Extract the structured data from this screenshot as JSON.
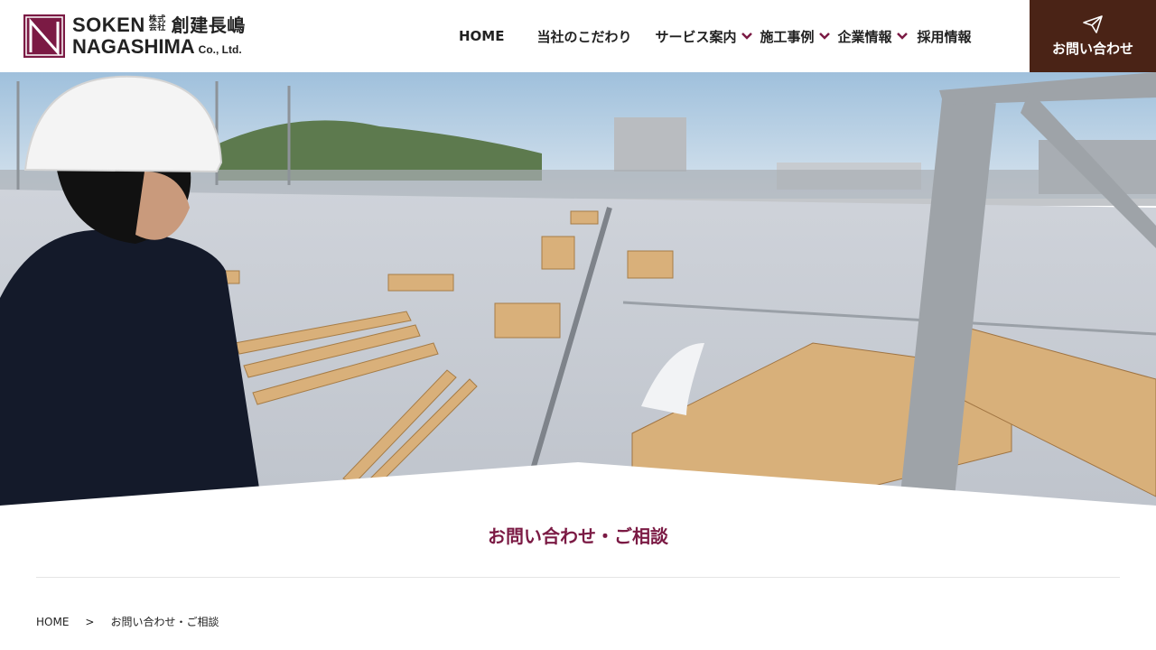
{
  "header": {
    "logo": {
      "line1": "SOKEN",
      "line1_sub": "株式\n会社",
      "line1_jp": "創建長嶋",
      "line2": "NAGASHIMA",
      "line2_co": "Co., Ltd."
    },
    "nav": [
      {
        "label": "HOME",
        "dropdown": false
      },
      {
        "label": "当社のこだわり",
        "dropdown": false
      },
      {
        "label": "サービス案内",
        "dropdown": true
      },
      {
        "label": "施工事例",
        "dropdown": true
      },
      {
        "label": "企業情報",
        "dropdown": true
      },
      {
        "label": "採用情報",
        "dropdown": false
      }
    ],
    "contact_button": {
      "label": "お問い合わせ",
      "icon": "paper-plane-icon"
    }
  },
  "hero": {
    "image": "construction-site-photo"
  },
  "page": {
    "title": "お問い合わせ・ご相談",
    "breadcrumb": {
      "home": "HOME",
      "separator": ">",
      "current": "お問い合わせ・ご相談"
    }
  },
  "colors": {
    "accent": "#7b1a44",
    "contact_bg": "#4a2316"
  }
}
